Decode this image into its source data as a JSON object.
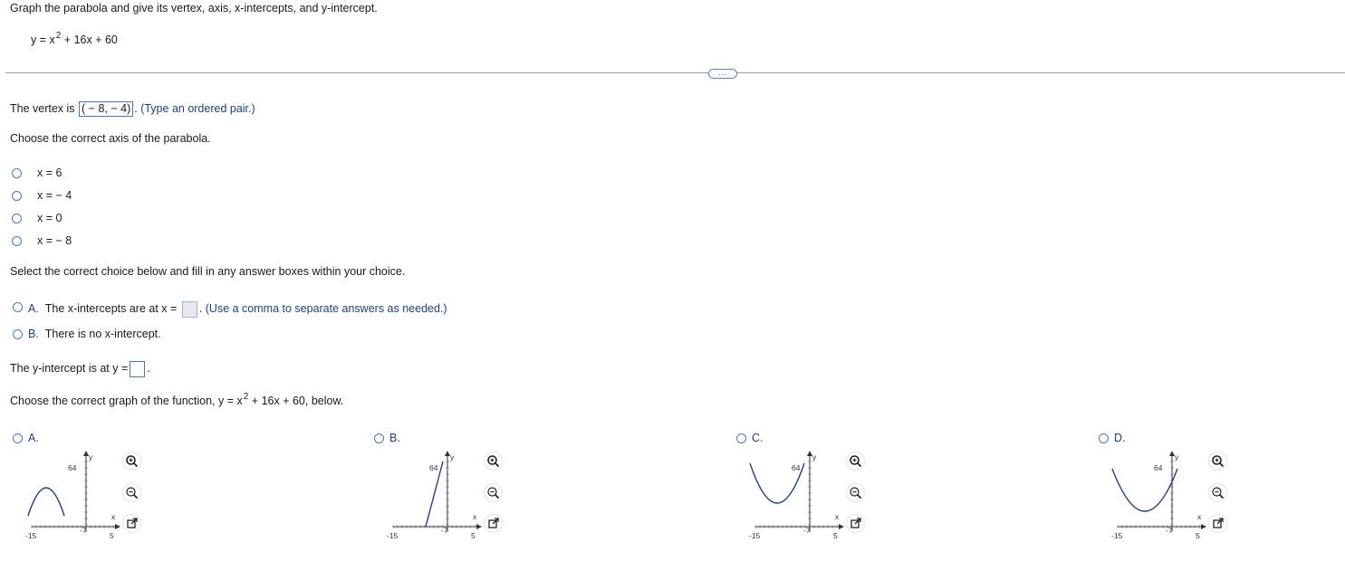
{
  "question": {
    "prompt": "Graph the parabola and give its vertex, axis, x-intercepts, and y-intercept.",
    "equation_lhs": "y = x",
    "equation_exp": "2",
    "equation_rhs": "+ 16x + 60"
  },
  "more_button_label": "…",
  "vertex": {
    "label": "The vertex is",
    "answer": "( − 8, − 4)",
    "hint": "(Type an ordered pair.)"
  },
  "axis": {
    "prompt": "Choose the correct axis of the parabola.",
    "options": [
      "x = 6",
      "x = − 4",
      "x = 0",
      "x = − 8"
    ]
  },
  "xint": {
    "prompt": "Select the correct choice below and fill in any answer boxes within your choice.",
    "a_letter": "A.",
    "a_text": "The x-intercepts are at x =",
    "a_hint": "(Use a comma to separate answers as needed.)",
    "b_letter": "B.",
    "b_text": "There is no x-intercept."
  },
  "yint": {
    "label": "The y-intercept is at y ="
  },
  "graph_question": {
    "prompt_pre": "Choose the correct graph of the function, y = x",
    "prompt_exp": "2",
    "prompt_post": "+ 16x + 60, below."
  },
  "graphs": [
    {
      "letter": "A.",
      "tick_y": "64",
      "tick_left": "-15",
      "tick_mid": "-7",
      "tick_right": "5",
      "axis_x": "x",
      "axis_y": "y"
    },
    {
      "letter": "B.",
      "tick_y": "64",
      "tick_left": "-15",
      "tick_mid": "-7",
      "tick_right": "5",
      "axis_x": "x",
      "axis_y": "y"
    },
    {
      "letter": "C.",
      "tick_y": "64",
      "tick_left": "-15",
      "tick_mid": "-7",
      "tick_right": "5",
      "axis_x": "x",
      "axis_y": "y"
    },
    {
      "letter": "D.",
      "tick_y": "64",
      "tick_left": "-15",
      "tick_mid": "-7",
      "tick_right": "5",
      "axis_x": "x",
      "axis_y": "y"
    }
  ],
  "colors": {
    "curve": "#1f3f87",
    "accent": "#4a78c0",
    "hint": "#1f3f87"
  }
}
